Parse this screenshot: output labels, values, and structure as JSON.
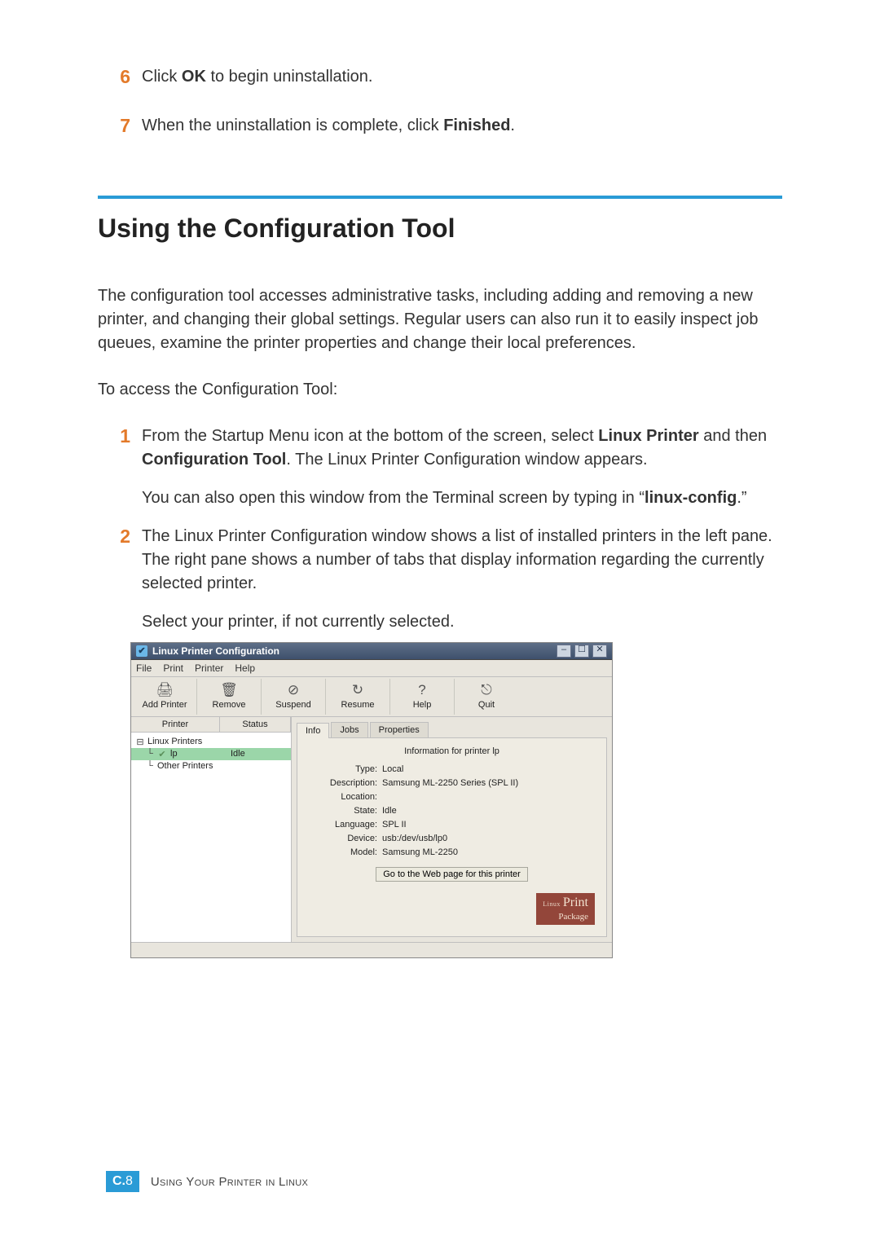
{
  "intro_steps": {
    "step6": {
      "num": "6",
      "text_before": "Click ",
      "bold": "OK",
      "text_after": " to begin uninstallation."
    },
    "step7": {
      "num": "7",
      "text_before": "When the uninstallation is complete, click ",
      "bold": "Finished",
      "text_after": "."
    }
  },
  "section_title": "Using the Configuration Tool",
  "intro_para": "The configuration tool accesses administrative tasks, including adding and removing a new printer, and changing their global settings. Regular users can also run it to easily inspect job queues, examine the printer properties and change their local preferences.",
  "access_line": "To access the Configuration Tool:",
  "step1": {
    "num": "1",
    "l1_a": "From the Startup Menu icon at the bottom of the screen, select ",
    "l1_b": "Linux Printer",
    "l1_c": " and then ",
    "l1_d": "Configuration Tool",
    "l1_e": ". The Linux Printer Configuration window appears.",
    "l2_a": "You can also open this window from the Terminal screen by typing in “",
    "l2_b": "linux-config",
    "l2_c": ".”"
  },
  "step2": {
    "num": "2",
    "p1": "The Linux Printer Configuration window shows a list of installed printers in the left pane. The right pane shows a number of tabs that display information regarding the currently selected printer.",
    "p2": "Select your printer, if not currently selected."
  },
  "window": {
    "title": "Linux Printer Configuration",
    "win_buttons": {
      "min": "–",
      "max": "☐",
      "close": "✕"
    },
    "menubar": [
      "File",
      "Print",
      "Printer",
      "Help"
    ],
    "toolbar": [
      {
        "icon": "🖨",
        "label": "Add Printer"
      },
      {
        "icon": "🗑",
        "label": "Remove"
      },
      {
        "icon": "⊘",
        "label": "Suspend"
      },
      {
        "icon": "↻",
        "label": "Resume"
      },
      {
        "icon": "?",
        "label": "Help"
      },
      {
        "icon": "⎋",
        "label": "Quit"
      }
    ],
    "tree_headers": {
      "printer": "Printer",
      "status": "Status"
    },
    "tree": {
      "root": {
        "toggle": "⊟",
        "label": "Linux Printers"
      },
      "selected": {
        "icon": "✔",
        "label": "lp",
        "status": "Idle"
      },
      "other": {
        "toggle": "└",
        "label": "Other Printers"
      }
    },
    "tabs": {
      "info": "Info",
      "jobs": "Jobs",
      "properties": "Properties"
    },
    "info_panel": {
      "heading": "Information for printer lp",
      "rows": [
        {
          "label": "Type:",
          "value": "Local"
        },
        {
          "label": "Description:",
          "value": "Samsung ML-2250 Series (SPL II)"
        },
        {
          "label": "Location:",
          "value": ""
        },
        {
          "label": "State:",
          "value": "Idle"
        },
        {
          "label": "Language:",
          "value": "SPL II"
        },
        {
          "label": "Device:",
          "value": "usb:/dev/usb/lp0"
        },
        {
          "label": "Model:",
          "value": "Samsung ML-2250"
        }
      ],
      "gotoweb": "Go to the Web page for this printer",
      "brand_prefix": "Linux",
      "brand_main": "Print",
      "brand_sub": "Package"
    }
  },
  "footer": {
    "badge_section": "C.",
    "badge_page": "8",
    "text": "Using Your Printer in Linux"
  }
}
